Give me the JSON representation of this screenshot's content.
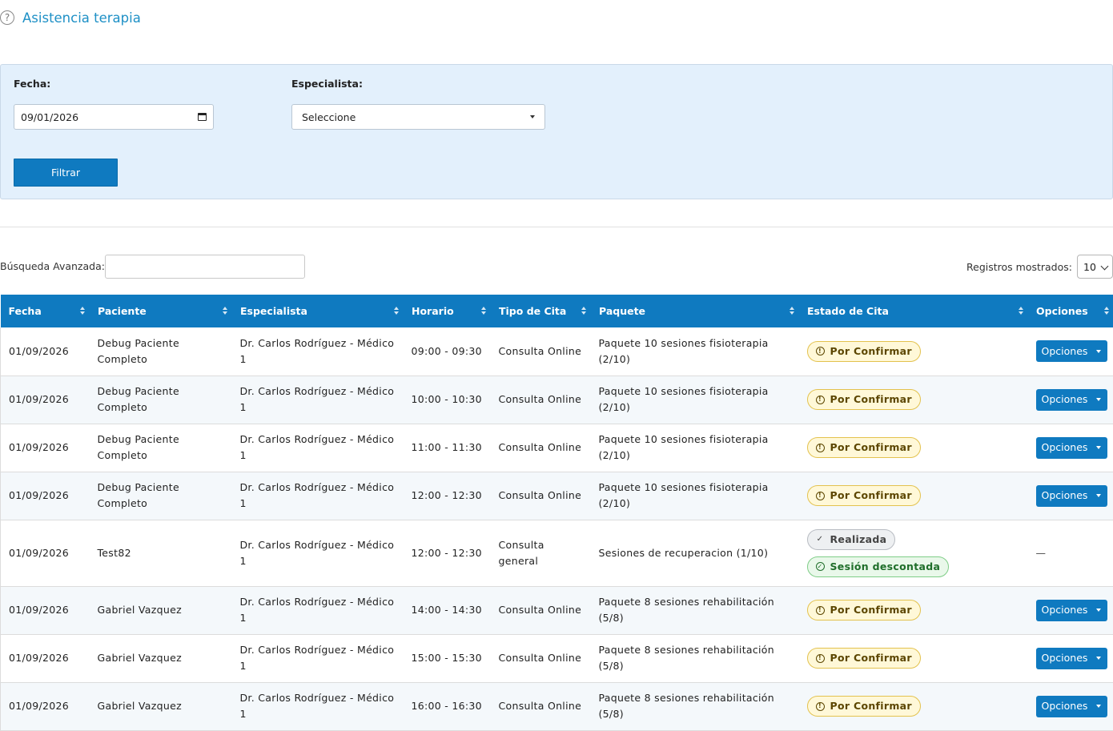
{
  "page": {
    "title": "Asistencia terapia",
    "help_icon": "help-circle-icon"
  },
  "filters": {
    "date_label": "Fecha:",
    "date_value": "09/01/2026",
    "specialist_label": "Especialista:",
    "specialist_value": "Seleccione",
    "filter_button": "Filtrar"
  },
  "table_controls": {
    "search_label": "Búsqueda Avanzada:",
    "search_value": "",
    "records_label": "Registros mostrados:",
    "records_value": "10"
  },
  "colors": {
    "primary": "#0f7ac0",
    "title": "#1e90c6",
    "panel_bg": "#e3f0fc",
    "pending_badge": "#fff8d8",
    "discount_badge": "#e9f8ea"
  },
  "table": {
    "headers": [
      "Fecha",
      "Paciente",
      "Especialista",
      "Horario",
      "Tipo de Cita",
      "Paquete",
      "Estado de Cita",
      "Opciones"
    ],
    "rows": [
      {
        "fecha": "01/09/2026",
        "paciente": "Debug Paciente Completo",
        "especialista": "Dr. Carlos Rodríguez - Médico 1",
        "horario": "09:00 - 09:30",
        "tipo": "Consulta Online",
        "paquete": "Paquete 10 sesiones fisioterapia (2/10)",
        "estado": "Por Confirmar",
        "opciones": "Opciones"
      },
      {
        "fecha": "01/09/2026",
        "paciente": "Debug Paciente Completo",
        "especialista": "Dr. Carlos Rodríguez - Médico 1",
        "horario": "10:00 - 10:30",
        "tipo": "Consulta Online",
        "paquete": "Paquete 10 sesiones fisioterapia (2/10)",
        "estado": "Por Confirmar",
        "opciones": "Opciones"
      },
      {
        "fecha": "01/09/2026",
        "paciente": "Debug Paciente Completo",
        "especialista": "Dr. Carlos Rodríguez - Médico 1",
        "horario": "11:00 - 11:30",
        "tipo": "Consulta Online",
        "paquete": "Paquete 10 sesiones fisioterapia (2/10)",
        "estado": "Por Confirmar",
        "opciones": "Opciones"
      },
      {
        "fecha": "01/09/2026",
        "paciente": "Debug Paciente Completo",
        "especialista": "Dr. Carlos Rodríguez - Médico 1",
        "horario": "12:00 - 12:30",
        "tipo": "Consulta Online",
        "paquete": "Paquete 10 sesiones fisioterapia (2/10)",
        "estado": "Por Confirmar",
        "opciones": "Opciones"
      },
      {
        "fecha": "01/09/2026",
        "paciente": "Test82",
        "especialista": "Dr. Carlos Rodríguez - Médico 1",
        "horario": "12:00 - 12:30",
        "tipo": "Consulta general",
        "paquete": "Sesiones de recuperacion (1/10)",
        "estado": "Realizada",
        "estado_extra": "Sesión descontada",
        "opciones": "—"
      },
      {
        "fecha": "01/09/2026",
        "paciente": "Gabriel Vazquez",
        "especialista": "Dr. Carlos Rodríguez - Médico 1",
        "horario": "14:00 - 14:30",
        "tipo": "Consulta Online",
        "paquete": "Paquete 8 sesiones rehabilitación (5/8)",
        "estado": "Por Confirmar",
        "opciones": "Opciones"
      },
      {
        "fecha": "01/09/2026",
        "paciente": "Gabriel Vazquez",
        "especialista": "Dr. Carlos Rodríguez - Médico 1",
        "horario": "15:00 - 15:30",
        "tipo": "Consulta Online",
        "paquete": "Paquete 8 sesiones rehabilitación (5/8)",
        "estado": "Por Confirmar",
        "opciones": "Opciones"
      },
      {
        "fecha": "01/09/2026",
        "paciente": "Gabriel Vazquez",
        "especialista": "Dr. Carlos Rodríguez - Médico 1",
        "horario": "16:00 - 16:30",
        "tipo": "Consulta Online",
        "paquete": "Paquete 8 sesiones rehabilitación (5/8)",
        "estado": "Por Confirmar",
        "opciones": "Opciones"
      }
    ]
  }
}
